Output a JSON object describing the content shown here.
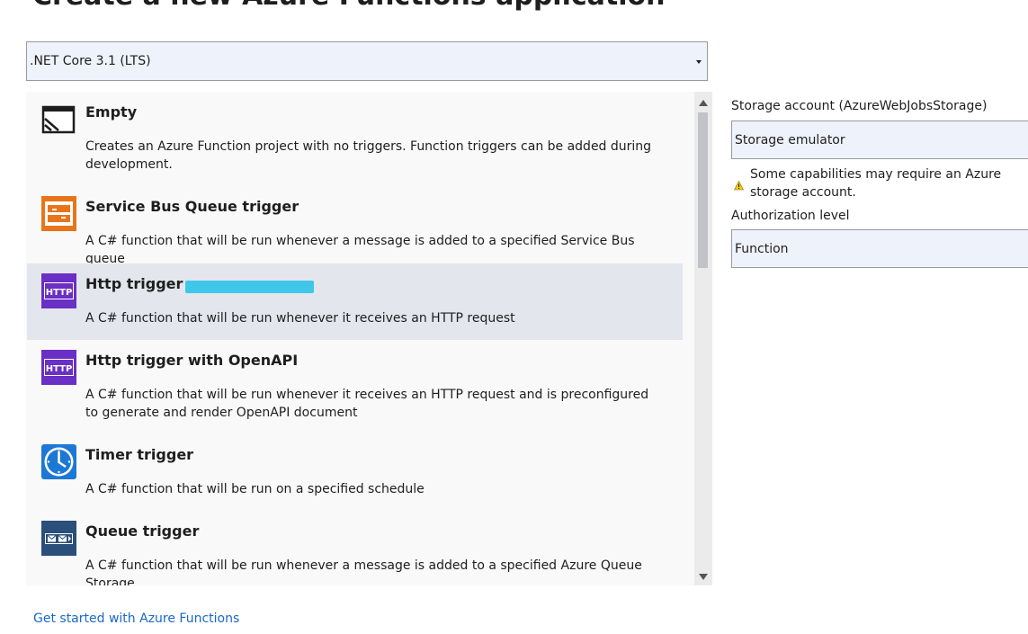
{
  "header": {
    "title": "Create a new Azure Functions application"
  },
  "framework": {
    "selected": ".NET Core 3.1 (LTS)"
  },
  "templates": [
    {
      "name": "Empty",
      "description": "Creates an Azure Function project with no triggers.  Function triggers can be added during development.",
      "icon": "empty-template-icon"
    },
    {
      "name": "Service Bus Queue trigger",
      "description": "A C# function that will be run whenever a message is added to a specified Service Bus queue",
      "icon": "service-bus-icon"
    },
    {
      "name": "Http trigger",
      "description": "A C# function that will be run whenever it receives an HTTP request",
      "icon": "http-icon",
      "selected": true
    },
    {
      "name": "Http trigger with OpenAPI",
      "description": "A C# function that will be run whenever it receives an HTTP request and is preconfigured to generate and render OpenAPI document",
      "icon": "http-icon"
    },
    {
      "name": "Timer trigger",
      "description": "A C# function that will be run on a specified schedule",
      "icon": "clock-icon"
    },
    {
      "name": "Queue trigger",
      "description": "A C# function that will be run whenever a message is added to a specified Azure Queue Storage",
      "icon": "queue-icon"
    }
  ],
  "icons": {
    "http_label": "HTTP"
  },
  "settings": {
    "storage_label": "Storage account (AzureWebJobsStorage)",
    "storage_value": "Storage emulator",
    "warning_text": "Some capabilities may require an Azure storage account.",
    "auth_label": "Authorization level",
    "auth_value": "Function"
  },
  "footer": {
    "link_text": "Get started with Azure Functions"
  },
  "colors": {
    "selection": "#e4e6ee",
    "link": "#1a68c8",
    "http_purple": "#6a2fc4",
    "service_bus_orange": "#e8751a",
    "timer_blue": "#1d78d5",
    "queue_navy": "#2a4f7a",
    "warning_yellow": "#f2c811",
    "redaction": "#3fc7ea"
  }
}
